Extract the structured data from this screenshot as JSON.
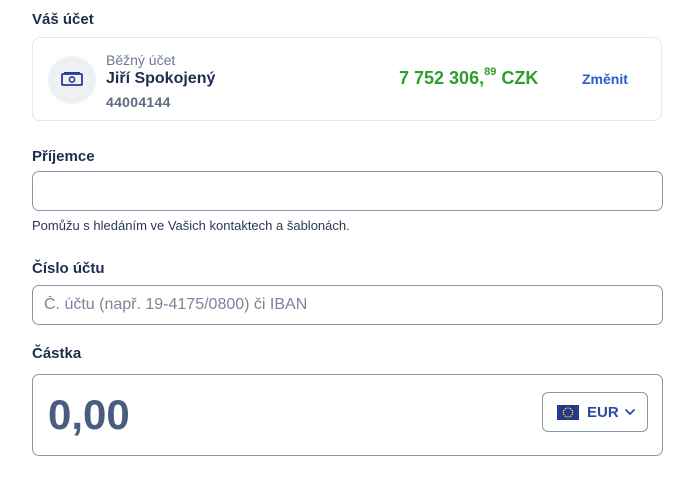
{
  "account_section": {
    "label": "Váš účet",
    "type": "Běžný účet",
    "owner": "Jiří Spokojený",
    "number": "44004144",
    "balance_integer": "7 752 306,",
    "balance_decimal": "89",
    "balance_currency": " CZK",
    "change_label": "Změnit",
    "balance_color": "#2e9d2e"
  },
  "recipient": {
    "label": "Příjemce",
    "value": "",
    "hint": "Pomůžu s hledáním ve Vašich kontaktech a šablonách."
  },
  "account_number": {
    "label": "Číslo účtu",
    "placeholder": "Č. účtu (např. 19-4175/0800) či IBAN"
  },
  "amount": {
    "label": "Částka",
    "value": "0,00",
    "currency": "EUR",
    "currency_flag_icon": "eu-flag-icon"
  },
  "colors": {
    "accent": "#2a59c9",
    "text_primary": "#1f2d4d"
  }
}
